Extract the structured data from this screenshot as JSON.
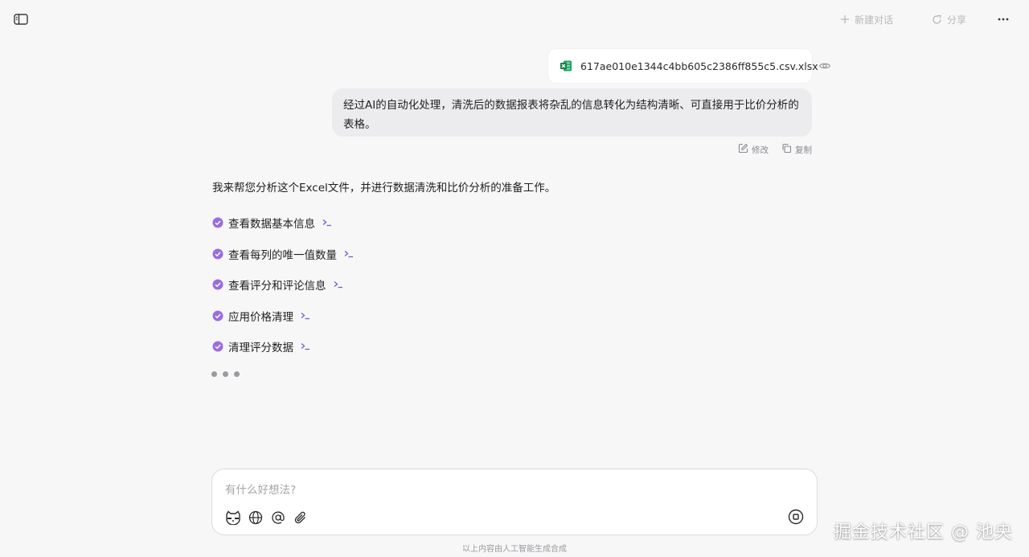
{
  "header": {
    "new_chat_label": "新建对话",
    "share_label": "分享"
  },
  "attachment": {
    "file_name": "617ae010e1344c4bb605c2386ff855c5.csv.xlsx"
  },
  "user_message": {
    "text": "经过AI的自动化处理，清洗后的数据报表将杂乱的信息转化为结构清晰、可直接用于比价分析的表格。",
    "edit_label": "修改",
    "copy_label": "复制"
  },
  "assistant": {
    "intro": "我来帮您分析这个Excel文件，并进行数据清洗和比价分析的准备工作。",
    "tasks": [
      {
        "label": "查看数据基本信息"
      },
      {
        "label": "查看每列的唯一值数量"
      },
      {
        "label": "查看评分和评论信息"
      },
      {
        "label": "应用价格清理"
      },
      {
        "label": "清理评分数据"
      }
    ]
  },
  "composer": {
    "placeholder": "有什么好想法?"
  },
  "footer": {
    "note": "以上内容由人工智能生成合成"
  },
  "watermark": "掘金技术社区 @ 池央",
  "colors": {
    "accent_purple": "#9b6ee0",
    "excel_green": "#1d9b6c",
    "background": "#f7f7f8",
    "bubble": "#ececee"
  }
}
